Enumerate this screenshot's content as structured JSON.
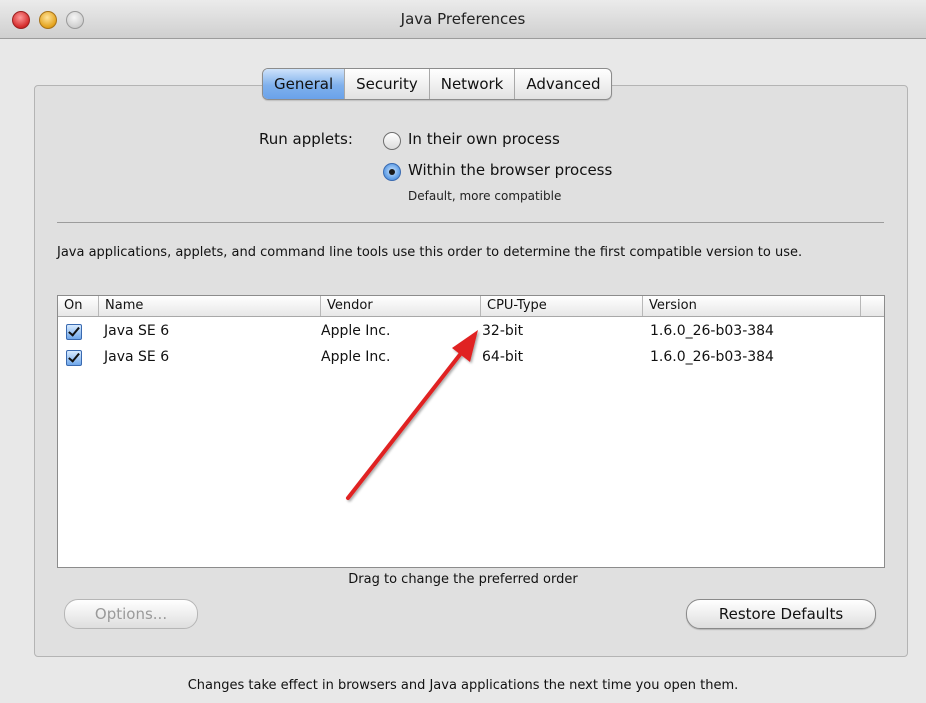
{
  "window": {
    "title": "Java Preferences"
  },
  "tabs": [
    {
      "label": "General",
      "active": true
    },
    {
      "label": "Security",
      "active": false
    },
    {
      "label": "Network",
      "active": false
    },
    {
      "label": "Advanced",
      "active": false
    }
  ],
  "run_applets": {
    "label": "Run applets:",
    "options": [
      {
        "label": "In their own process",
        "selected": false
      },
      {
        "label": "Within the browser process",
        "selected": true,
        "sublabel": "Default, more compatible"
      }
    ]
  },
  "info_text": "Java applications, applets, and command line tools use this order to determine the first compatible version to use.",
  "table": {
    "columns": [
      "On",
      "Name",
      "Vendor",
      "CPU-Type",
      "Version"
    ],
    "rows": [
      {
        "on": true,
        "name": "Java SE 6",
        "vendor": "Apple Inc.",
        "cpu_type": "32-bit",
        "version": "1.6.0_26-b03-384"
      },
      {
        "on": true,
        "name": "Java SE 6",
        "vendor": "Apple Inc.",
        "cpu_type": "64-bit",
        "version": "1.6.0_26-b03-384"
      }
    ]
  },
  "drag_hint": "Drag to change the preferred order",
  "buttons": {
    "options": "Options...",
    "restore_defaults": "Restore Defaults"
  },
  "footer": "Changes take effect in browsers and Java applications the next time you open them.",
  "colors": {
    "accent_tab": "#7fb0ec",
    "annotation_arrow": "#e02020"
  }
}
